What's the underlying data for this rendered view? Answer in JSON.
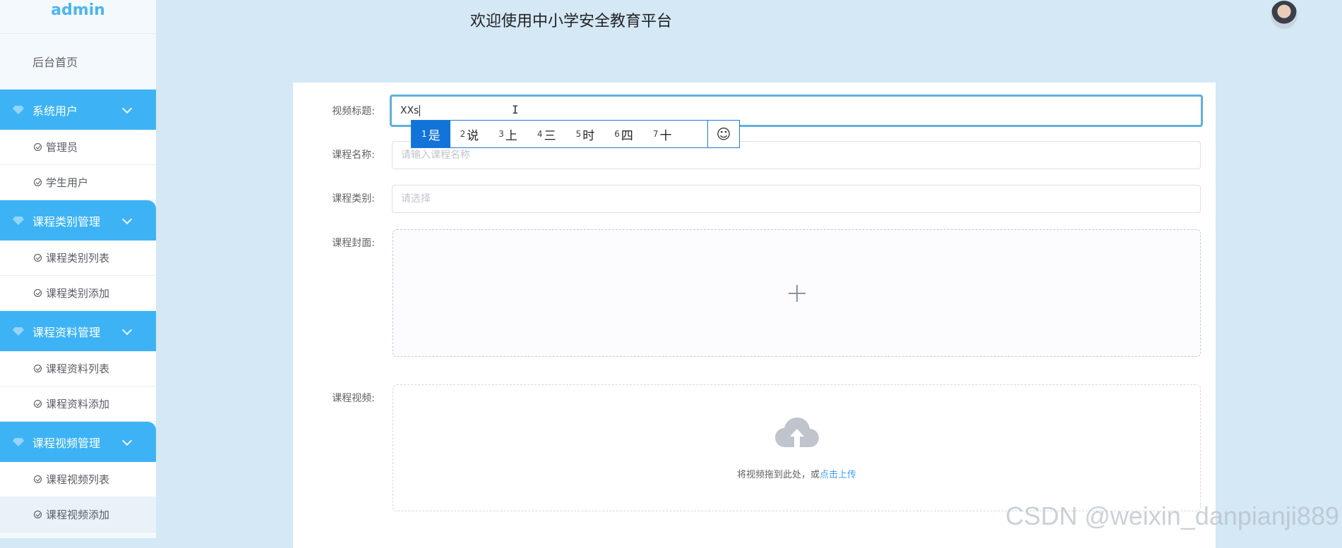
{
  "sidebar": {
    "brand": "admin",
    "home": "后台首页",
    "groups": [
      {
        "label": "系统用户",
        "items": [
          "管理员",
          "学生用户"
        ]
      },
      {
        "label": "课程类别管理",
        "items": [
          "课程类别列表",
          "课程类别添加"
        ]
      },
      {
        "label": "课程资料管理",
        "items": [
          "课程资料列表",
          "课程资料添加"
        ]
      },
      {
        "label": "课程视频管理",
        "items": [
          "课程视频列表",
          "课程视频添加"
        ]
      }
    ]
  },
  "header": {
    "title": "欢迎使用中小学安全教育平台"
  },
  "form": {
    "video_title": {
      "label": "视频标题:",
      "value": "XXs"
    },
    "course_name": {
      "label": "课程名称:",
      "placeholder": "请输入课程名称"
    },
    "course_type": {
      "label": "课程类别:",
      "placeholder": "请选择"
    },
    "course_cover": {
      "label": "课程封面:"
    },
    "course_video": {
      "label": "课程视频:",
      "hint": "将视频拖到此处，或",
      "link": "点击上传"
    }
  },
  "ime": {
    "candidates": [
      {
        "n": "1",
        "t": "是"
      },
      {
        "n": "2",
        "t": "说"
      },
      {
        "n": "3",
        "t": "上"
      },
      {
        "n": "4",
        "t": "三"
      },
      {
        "n": "5",
        "t": "时"
      },
      {
        "n": "6",
        "t": "四"
      },
      {
        "n": "7",
        "t": "十"
      }
    ],
    "emoji": "☺"
  },
  "watermark": "CSDN @weixin_danpianji889",
  "colors": {
    "accent": "#3db3f5",
    "background": "#d4e8f6",
    "link": "#409eff"
  }
}
